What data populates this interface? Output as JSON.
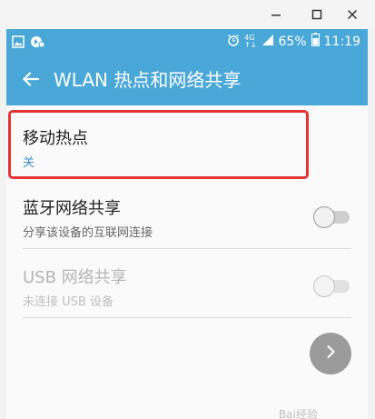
{
  "window": {
    "minimize_icon": "minimize-icon",
    "maximize_icon": "maximize-icon",
    "close_icon": "close-icon"
  },
  "status_bar": {
    "left_icons": [
      "gallery-icon",
      "notification-icon"
    ],
    "network_label_top": "4G",
    "network_label_bottom": "↑↓",
    "battery_percent": "65%",
    "time": "11:19",
    "color": "#4aa8d8"
  },
  "app_bar": {
    "title": "WLAN 热点和网络共享",
    "back_icon": "arrow-left-icon"
  },
  "items": [
    {
      "title": "移动热点",
      "subtitle": "关",
      "highlighted": true
    },
    {
      "title": "蓝牙网络共享",
      "subtitle": "分享该设备的互联网连接",
      "switch_on": false,
      "enabled": true
    },
    {
      "title": "USB 网络共享",
      "subtitle": "未连接 USB 设备",
      "switch_on": false,
      "enabled": false
    }
  ],
  "fab": {
    "icon": "chevron-right-icon"
  },
  "watermark": "Bai经验"
}
